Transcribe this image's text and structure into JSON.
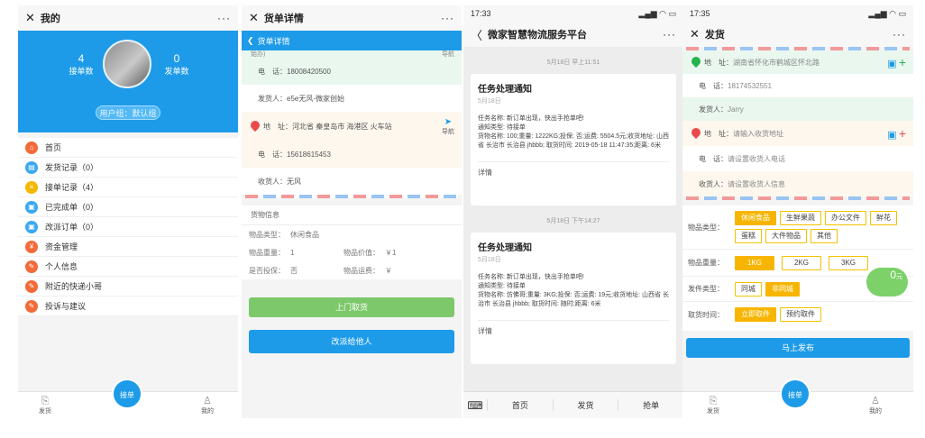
{
  "phone1": {
    "title": "我的",
    "menu_dots": "···",
    "stats": [
      {
        "num": "4",
        "label": "接单数"
      },
      {
        "num": "0",
        "label": "发单数"
      }
    ],
    "group": "用户组：默认组",
    "menu": [
      {
        "label": "首页",
        "color": "#f36b3a",
        "icon": "home-icon"
      },
      {
        "label": "发货记录（0）",
        "color": "#3aa8f0",
        "icon": "truck-icon"
      },
      {
        "label": "接单记录（4）",
        "color": "#f5b800",
        "icon": "list-icon"
      },
      {
        "label": "已完成单（0）",
        "color": "#3aa8f0",
        "icon": "check-doc-icon"
      },
      {
        "label": "改派订单（0）",
        "color": "#3aa8f0",
        "icon": "doc-icon"
      },
      {
        "label": "资金管理",
        "color": "#f36b3a",
        "icon": "yen-icon"
      },
      {
        "label": "个人信息",
        "color": "#f36b3a",
        "icon": "edit-icon"
      },
      {
        "label": "附近的快递小哥",
        "color": "#f36b3a",
        "icon": "edit-icon"
      },
      {
        "label": "投诉与建议",
        "color": "#f36b3a",
        "icon": "edit-icon"
      }
    ],
    "tabs": {
      "left": "发货",
      "fab": "接单",
      "right": "我的"
    }
  },
  "phone2": {
    "title": "货单详情",
    "menu_dots": "···",
    "back_label": "货单详情",
    "sender": {
      "cut_label": "始办)",
      "nav_cut": "导航",
      "phone_label": "电　话：",
      "phone": "18008420500",
      "sender_label": "发货人：",
      "sender": "e5e无风-微家创始"
    },
    "receiver": {
      "addr_label": "地　址：",
      "addr": "河北省 秦皇岛市 海港区 火车站",
      "nav": "导航",
      "phone_label": "电　话：",
      "phone": "15618615453",
      "name_label": "收货人：",
      "name": "无风"
    },
    "goods_title": "货物信息",
    "goods": [
      {
        "k1": "物品类型：",
        "v1": "休闲食品",
        "k2": "",
        "v2": ""
      },
      {
        "k1": "物品重量：",
        "v1": "1",
        "k2": "物品价值：",
        "v2": "￥1"
      },
      {
        "k1": "是否投保：",
        "v1": "否",
        "k2": "物品运费：",
        "v2": "￥"
      }
    ],
    "btn_pickup": "上门取货",
    "btn_reassign": "改派给他人"
  },
  "phone3": {
    "time": "17:33",
    "title": "微家智慧物流服务平台",
    "menu_dots": "···",
    "messages": [
      {
        "stamp": "5月18日 早上11:51",
        "title": "任务处理通知",
        "date": "5月18日",
        "body": "任务名称: 新订单出现，快出手抢单吧!\n通知类型: 待接单\n货物名称: 100;重量: 1222KG;投保: 否;运费: 5504.5元;收货地址: 山西省 长治市 长治县 jhbbb; 取货时间: 2019-05-18 11:47:35;距离: 6米",
        "detail": "详情"
      },
      {
        "stamp": "5月18日 下午14:27",
        "title": "任务处理通知",
        "date": "5月18日",
        "body": "任务名称: 新订单出现，快出手抢单吧!\n通知类型: 待接单\n货物名称: 仿佛哥;重量: 3KG;投保: 否;运费: 19元;收货地址: 山西省 长治市 长治县 jhbbb; 取货时间: 随时;距离: 6米",
        "detail": "详情"
      }
    ],
    "bottom": [
      "首页",
      "发货",
      "抢单"
    ]
  },
  "phone4": {
    "time": "17:35",
    "title": "发货",
    "menu_dots": "···",
    "sender": {
      "addr_label": "地　址：",
      "addr": "湖南省怀化市鹤城区怀北路",
      "phone_label": "电　话：",
      "phone": "18174532551",
      "name_label": "发货人：",
      "name": "Jarry"
    },
    "receiver": {
      "addr_label": "地　址：",
      "addr": "请输入收货地址",
      "phone_label": "电　话：",
      "phone": "请设置收货人电话",
      "name_label": "收货人：",
      "name": "请设置收货人信息"
    },
    "type_label": "物品类型：",
    "types": [
      {
        "label": "休闲食品",
        "sel": true
      },
      {
        "label": "生鲜果蔬",
        "sel": false
      },
      {
        "label": "办公文件",
        "sel": false
      },
      {
        "label": "鲜花",
        "sel": false
      },
      {
        "label": "蛋糕",
        "sel": false
      },
      {
        "label": "大件物品",
        "sel": false
      },
      {
        "label": "其他",
        "sel": false
      }
    ],
    "weight_label": "物品重量：",
    "weights": [
      {
        "label": "1KG",
        "sel": true
      },
      {
        "label": "2KG",
        "sel": false
      },
      {
        "label": "3KG",
        "sel": false
      }
    ],
    "price": "0",
    "price_unit": "元",
    "ship_label": "发件类型：",
    "ships": [
      {
        "label": "同城",
        "sel": false
      },
      {
        "label": "非同城",
        "sel": true
      }
    ],
    "pick_label": "取货时间：",
    "picks": [
      {
        "label": "立即取件",
        "sel": true
      },
      {
        "label": "预约取件",
        "sel": false
      }
    ],
    "submit": "马上发布",
    "tabs": {
      "left": "发货",
      "fab": "接单",
      "right": "我的"
    }
  }
}
